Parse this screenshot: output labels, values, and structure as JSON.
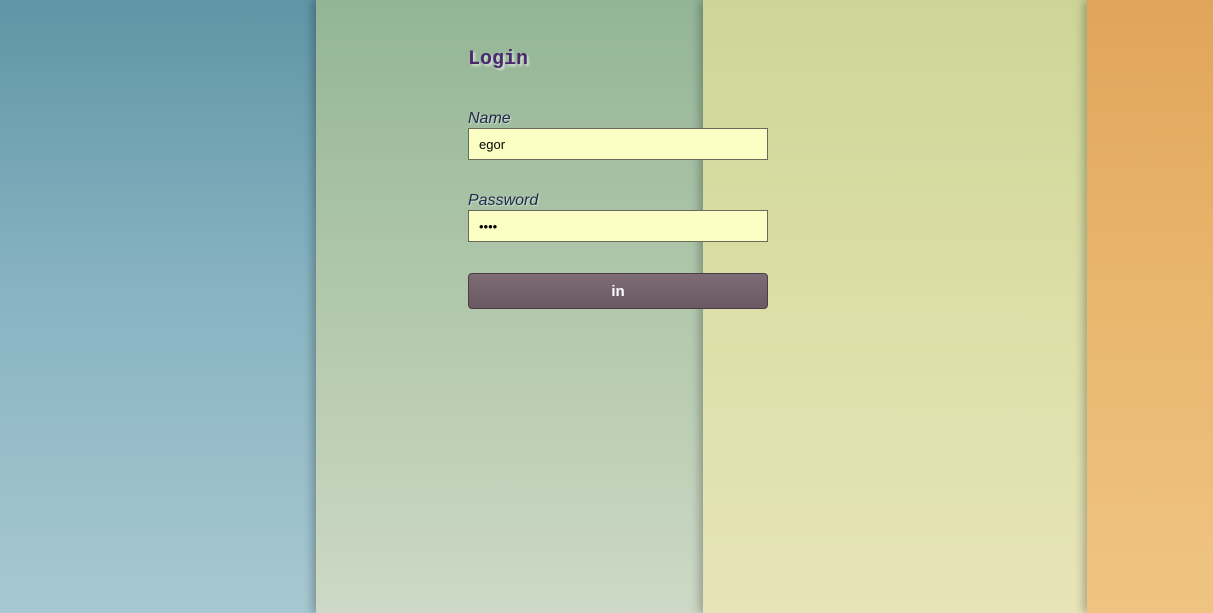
{
  "login": {
    "title": "Login",
    "name_label": "Name",
    "name_value": "egor",
    "password_label": "Password",
    "password_value": "egor",
    "submit_label": "in"
  },
  "colors": {
    "title": "#4a2a6e",
    "label": "#1f2a4a",
    "input_bg": "#fbffc4",
    "button_bg": "#75636d",
    "panel_blue": "#86b2c0",
    "panel_green": "#b2c8ac",
    "panel_yellow": "#dcdfa8",
    "panel_orange": "#e9b76e"
  }
}
